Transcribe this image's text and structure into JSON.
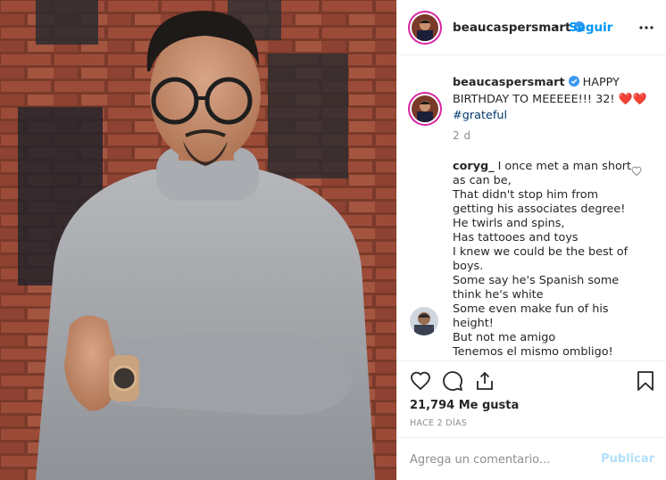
{
  "post": {
    "username": "beaucaspersmart",
    "follow_label": "Seguir",
    "separator": "•",
    "caption_text": "HAPPY BIRTHDAY TO MEEEEE!!! 32! ❤️❤️",
    "hashtag": "#grateful",
    "time_ago": "2 d"
  },
  "comment": {
    "username": "coryg_",
    "lines": [
      "I once met a man short",
      "as can be,",
      "That didn't stop him from",
      "getting his associates degree!",
      "He twirls and spins,",
      "Has tattooes and toys",
      "I knew we could be the best of",
      "boys.",
      "Some say he's Spanish some",
      "think he's white",
      "Some even make fun of his",
      "height!",
      "But not me amigo",
      "Tenemos el mismo ombligo!"
    ]
  },
  "actions": {
    "likes": "21,794 Me gusta",
    "date": "HACE 2 DÍAS"
  },
  "add_comment": {
    "placeholder": "Agrega un comentario...",
    "post_label": "Publicar"
  },
  "icons": {
    "verified": "verified-badge-icon",
    "more": "more-options-icon",
    "like": "heart-icon",
    "comment": "comment-bubble-icon",
    "share": "share-icon",
    "save": "bookmark-icon"
  },
  "colors": {
    "link_blue": "#0095f6",
    "hashtag": "#00376b",
    "muted": "#8e8e8e",
    "heart_red": "#ed4956",
    "ring": "#d6249f"
  }
}
